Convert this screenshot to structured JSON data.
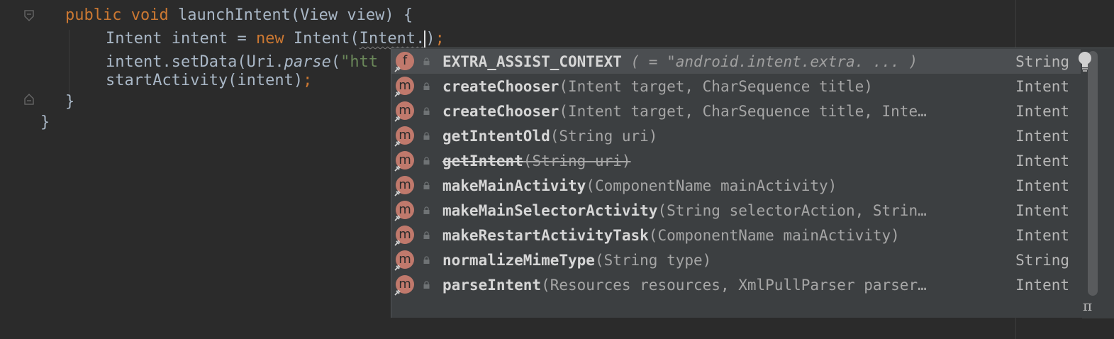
{
  "code": {
    "line1": {
      "kw1": "public",
      "kw2": "void",
      "rest": "launchIntent(View view) {"
    },
    "line2": {
      "type": "Intent",
      "decl": " intent = ",
      "kw": "new",
      "ctor": " Intent(",
      "typed": "Intent.",
      "close": ")",
      "semi": ";"
    },
    "line3": {
      "pre": "intent.setData(Uri.",
      "method": "parse",
      "open": "(",
      "str": "\"htt"
    },
    "line4": {
      "call": "startActivity(intent)",
      "semi": ";"
    },
    "line5": "}",
    "line6": "}"
  },
  "completion": {
    "items": [
      {
        "kind": "f",
        "name": "EXTRA_ASSIST_CONTEXT",
        "params": " ( = \"android.intent.extra. ... )",
        "ret": "String",
        "selected": true,
        "deprecated": false
      },
      {
        "kind": "m",
        "name": "createChooser",
        "params": "(Intent target, CharSequence title)",
        "ret": "Intent"
      },
      {
        "kind": "m",
        "name": "createChooser",
        "params": "(Intent target, CharSequence title, Inte…",
        "ret": "Intent"
      },
      {
        "kind": "m",
        "name": "getIntentOld",
        "params": "(String uri)",
        "ret": "Intent"
      },
      {
        "kind": "m",
        "name": "getIntent",
        "params": "(String uri)",
        "ret": "Intent",
        "deprecated": true
      },
      {
        "kind": "m",
        "name": "makeMainActivity",
        "params": "(ComponentName mainActivity)",
        "ret": "Intent"
      },
      {
        "kind": "m",
        "name": "makeMainSelectorActivity",
        "params": "(String selectorAction, Strin…",
        "ret": "Intent"
      },
      {
        "kind": "m",
        "name": "makeRestartActivityTask",
        "params": "(ComponentName mainActivity)",
        "ret": "Intent"
      },
      {
        "kind": "m",
        "name": "normalizeMimeType",
        "params": "(String type)",
        "ret": "String"
      },
      {
        "kind": "m",
        "name": "parseIntent",
        "params": "(Resources resources, XmlPullParser parser…",
        "ret": "Intent"
      }
    ],
    "footer_symbol": "π"
  },
  "icons": {
    "fold": "fold-marker-icon",
    "bulb": "lightbulb-icon",
    "lock": "lock-icon",
    "pin": "pin-icon"
  },
  "colors": {
    "background": "#2b2b2b",
    "keyword": "#cc7832",
    "text": "#a9b7c6",
    "string": "#6a8759",
    "popup": "#3c3f41",
    "selected_row": "#4b4e51",
    "badge": "#c0796c"
  }
}
